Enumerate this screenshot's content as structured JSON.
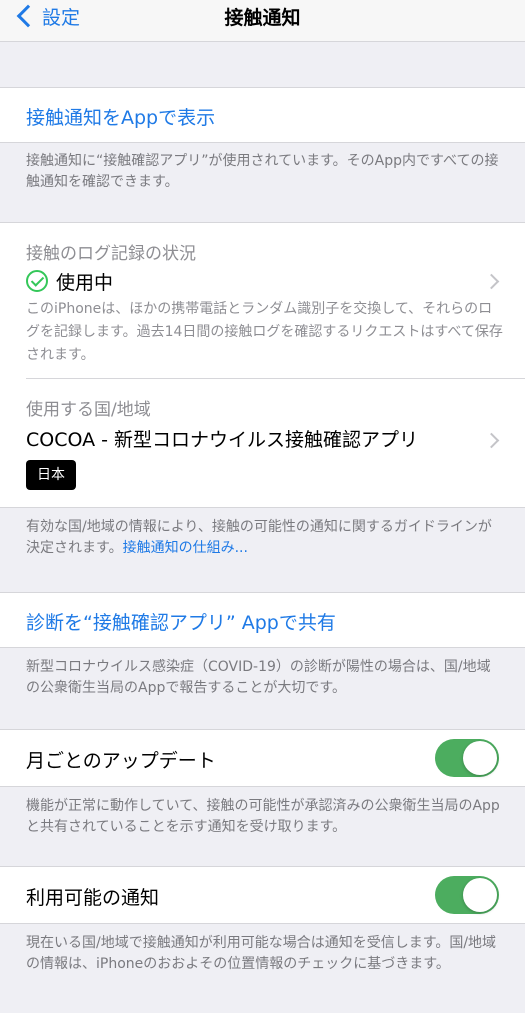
{
  "nav": {
    "back_label": "設定",
    "title": "接触通知"
  },
  "section1": {
    "link": "接触通知をAppで表示",
    "footer": "接触通知に“接触確認アプリ”が使用されています。そのApp内ですべての接触通知を確認できます。"
  },
  "section2": {
    "log_header": "接触のログ記録の状況",
    "status_label": "使用中",
    "log_description": "このiPhoneは、ほかの携帯電話とランダム識別子を交換して、それらのログを記録します。過去14日間の接触ログを確認するリクエストはすべて保存されます。",
    "region_header": "使用する国/地域",
    "app_name": "COCOA - 新型コロナウイルス接触確認アプリ",
    "country_badge": "日本",
    "footer_text": "有効な国/地域の情報により、接触の可能性の通知に関するガイドラインが決定されます。",
    "footer_link": "接触通知の仕組み..."
  },
  "section3": {
    "link": "診断を“接触確認アプリ” Appで共有",
    "footer": "新型コロナウイルス感染症（COVID-19）の診断が陽性の場合は、国/地域の公衆衛生当局のAppで報告することが大切です。"
  },
  "section4": {
    "label": "月ごとのアップデート",
    "toggle_on": true,
    "footer": "機能が正常に動作していて、接触の可能性が承認済みの公衆衛生当局のAppと共有されていることを示す通知を受け取ります。"
  },
  "section5": {
    "label": "利用可能の通知",
    "toggle_on": true,
    "footer": "現在いる国/地域で接触通知が利用可能な場合は通知を受信します。国/地域の情報は、iPhoneのおおよその位置情報のチェックに基づきます。"
  },
  "colors": {
    "accent": "#1f7ae6",
    "toggle_on": "#4cad5f",
    "status_green": "#34c759",
    "background": "#efeff4"
  },
  "icons": {
    "back": "chevron-left-icon",
    "status": "checkmark-circle-icon",
    "disclosure": "chevron-right-icon"
  }
}
